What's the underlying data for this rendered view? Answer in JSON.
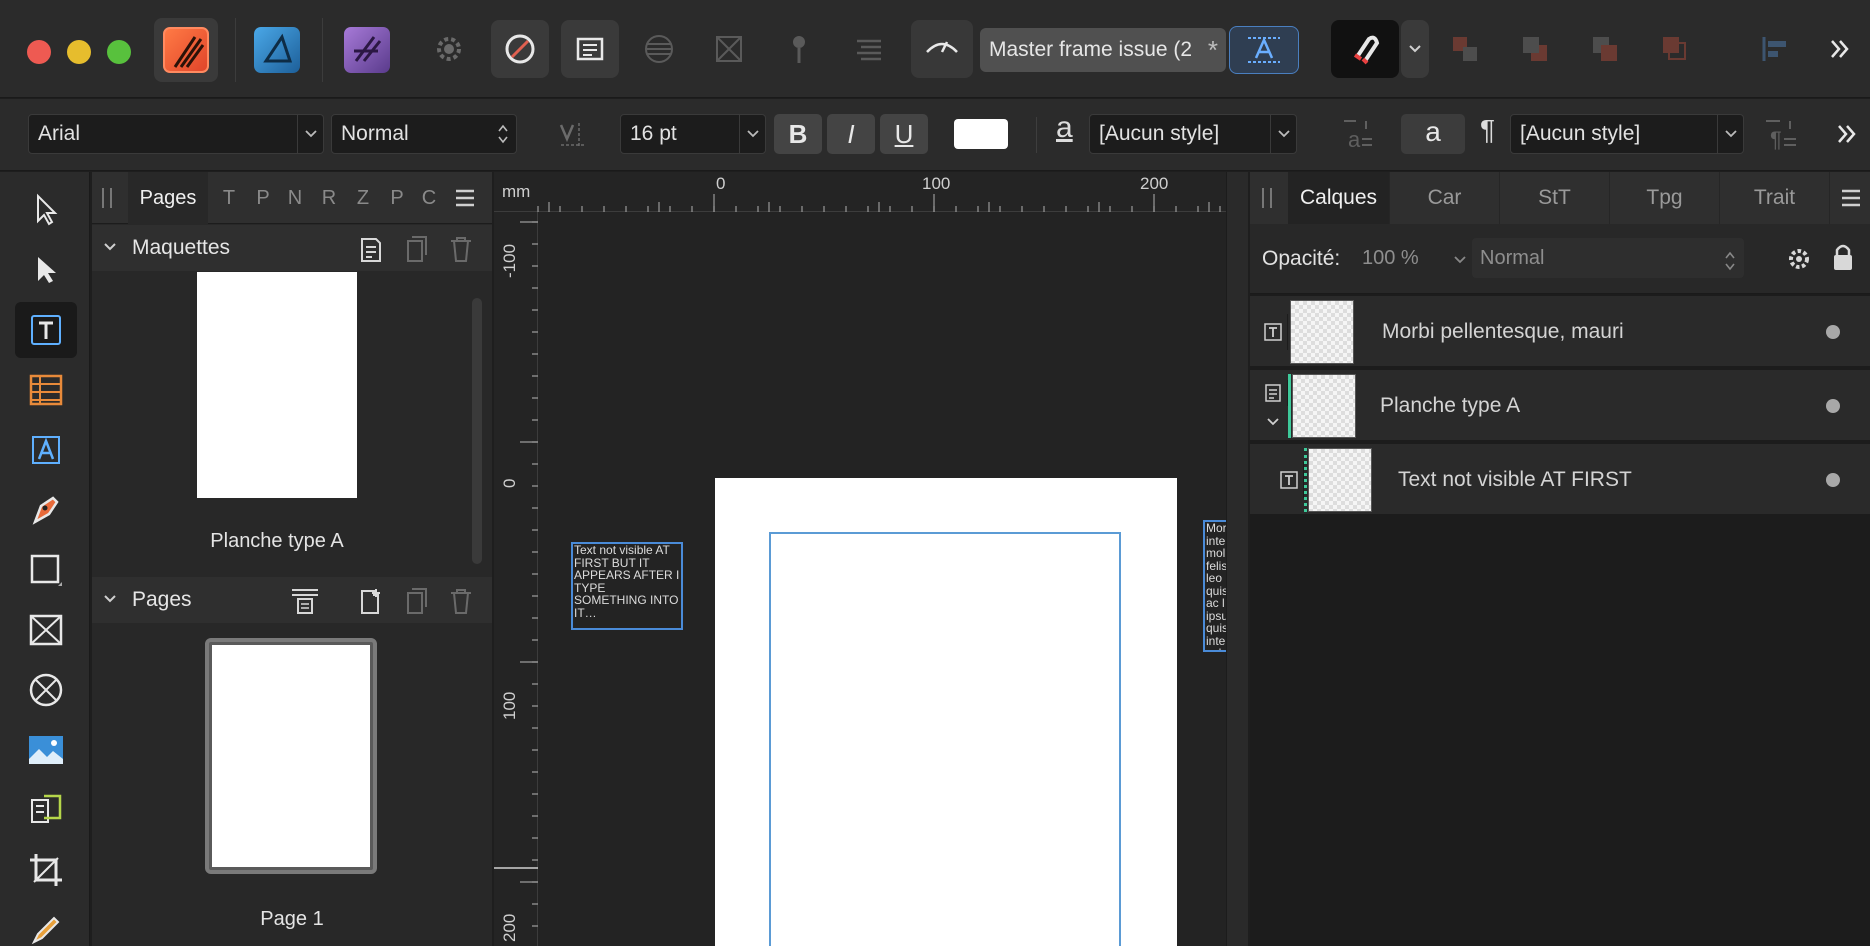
{
  "app": {
    "document_tab": "Master frame issue (2",
    "document_tab_modified": "*"
  },
  "context": {
    "font_family": "Arial",
    "font_style": "Normal",
    "font_size": "16 pt",
    "bold_label": "B",
    "italic_label": "I",
    "underline_label": "U",
    "char_style_glyph": "a",
    "char_style": "[Aucun style]",
    "para_glyph": "a",
    "para_mark": "¶",
    "para_style": "[Aucun style]"
  },
  "left_panel": {
    "tabs": [
      "Pages",
      "T",
      "P",
      "N",
      "R",
      "Z",
      "P",
      "C"
    ],
    "masters_title": "Maquettes",
    "master_item": "Planche type A",
    "pages_title": "Pages",
    "page_item": "Page 1"
  },
  "canvas": {
    "unit": "mm",
    "h_ticks": [
      "0",
      "100",
      "200"
    ],
    "v_ticks": [
      "-100",
      "0",
      "100",
      "200"
    ],
    "frame_left_text": "Text not visible AT FIRST BUT IT APPEARS AFTER I TYPE SOMETHING INTO IT…",
    "frame_right_text": "Mor inte mol felis leo quis ac l ipsu quis inte veh nisi"
  },
  "right_panel": {
    "tabs": [
      "Calques",
      "Car",
      "StT",
      "Tpg",
      "Trait"
    ],
    "opacity_label": "Opacité:",
    "opacity_value": "100 %",
    "blend_mode": "Normal",
    "layers": [
      {
        "name": "Morbi pellentesque, mauri",
        "kind": "text"
      },
      {
        "name": "Planche type A",
        "kind": "master"
      },
      {
        "name": "Text not visible AT FIRST",
        "kind": "text"
      }
    ]
  },
  "colors": {
    "accent": "#4a8bd8",
    "master_accent": "#3ec99a"
  }
}
